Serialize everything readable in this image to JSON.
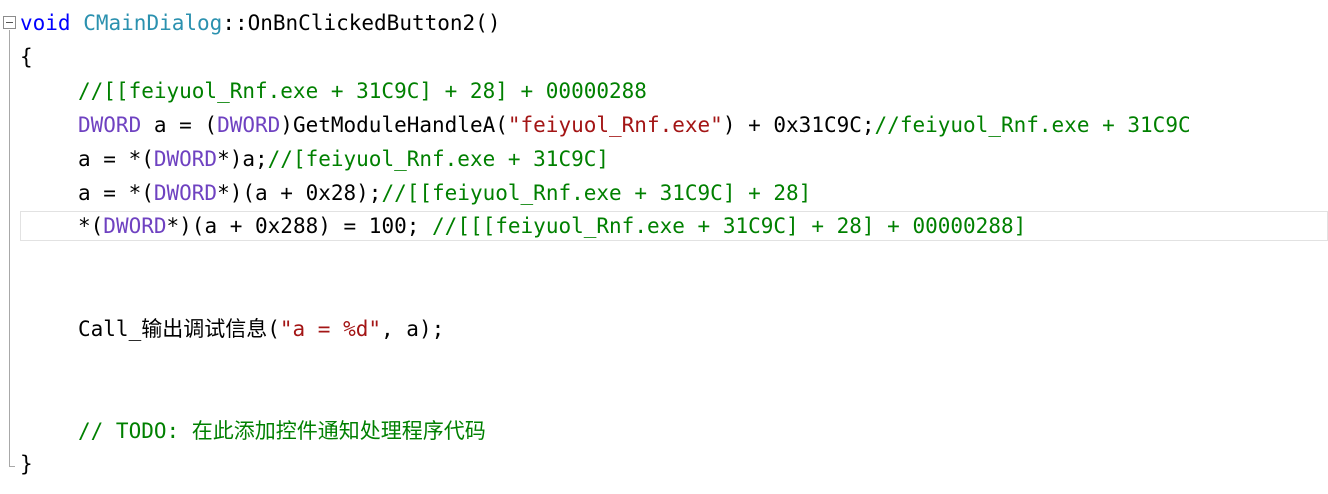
{
  "editor": {
    "lines": [
      {
        "id": "l1",
        "tokens": [
          {
            "t": "void",
            "c": "kw"
          },
          {
            "t": " ",
            "c": "op"
          },
          {
            "t": "CMainDialog",
            "c": "type"
          },
          {
            "t": "::OnBnClickedButton2()",
            "c": "op"
          }
        ]
      },
      {
        "id": "l2",
        "tokens": [
          {
            "t": "{",
            "c": "op"
          }
        ]
      },
      {
        "id": "l3",
        "tokens": [
          {
            "t": "//[[feiyuol_Rnf.exe + 31C9C] + 28] + 00000288",
            "c": "cm"
          }
        ]
      },
      {
        "id": "l4",
        "tokens": [
          {
            "t": "DWORD",
            "c": "macro"
          },
          {
            "t": " a = (",
            "c": "op"
          },
          {
            "t": "DWORD",
            "c": "macro"
          },
          {
            "t": ")GetModuleHandleA(",
            "c": "op"
          },
          {
            "t": "\"feiyuol_Rnf.exe\"",
            "c": "str"
          },
          {
            "t": ") + 0x31C9C;",
            "c": "op"
          },
          {
            "t": "//feiyuol_Rnf.exe + 31C9C",
            "c": "cm"
          }
        ]
      },
      {
        "id": "l5",
        "tokens": [
          {
            "t": "a = *(",
            "c": "op"
          },
          {
            "t": "DWORD",
            "c": "macro"
          },
          {
            "t": "*)a;",
            "c": "op"
          },
          {
            "t": "//[feiyuol_Rnf.exe + 31C9C]",
            "c": "cm"
          }
        ]
      },
      {
        "id": "l6",
        "tokens": [
          {
            "t": "a = *(",
            "c": "op"
          },
          {
            "t": "DWORD",
            "c": "macro"
          },
          {
            "t": "*)(a + 0x28);",
            "c": "op"
          },
          {
            "t": "//[[feiyuol_Rnf.exe + 31C9C] + 28]",
            "c": "cm"
          }
        ]
      },
      {
        "id": "l7",
        "tokens": [
          {
            "t": "*(",
            "c": "op"
          },
          {
            "t": "DWORD",
            "c": "macro"
          },
          {
            "t": "*)(a + 0x288) = 100; ",
            "c": "op"
          },
          {
            "t": "//[[[feiyuol_Rnf.exe + 31C9C] + 28] + 00000288]",
            "c": "cm"
          }
        ]
      },
      {
        "id": "l8",
        "tokens": [
          {
            "t": "Call_输出调试信息(",
            "c": "op"
          },
          {
            "t": "\"a = %d\"",
            "c": "str"
          },
          {
            "t": ", a);",
            "c": "op"
          }
        ]
      },
      {
        "id": "l9",
        "tokens": [
          {
            "t": "// TODO: 在此添加控件通知处理程序代码",
            "c": "cm"
          }
        ]
      },
      {
        "id": "l10",
        "tokens": [
          {
            "t": "}",
            "c": "op"
          }
        ]
      }
    ]
  },
  "colors": {
    "keyword": "#0000ff",
    "type": "#2b91af",
    "macro": "#6f42c1",
    "string": "#a31515",
    "comment": "#008000"
  },
  "icons": {
    "collapse": "collapse-minus-icon"
  }
}
